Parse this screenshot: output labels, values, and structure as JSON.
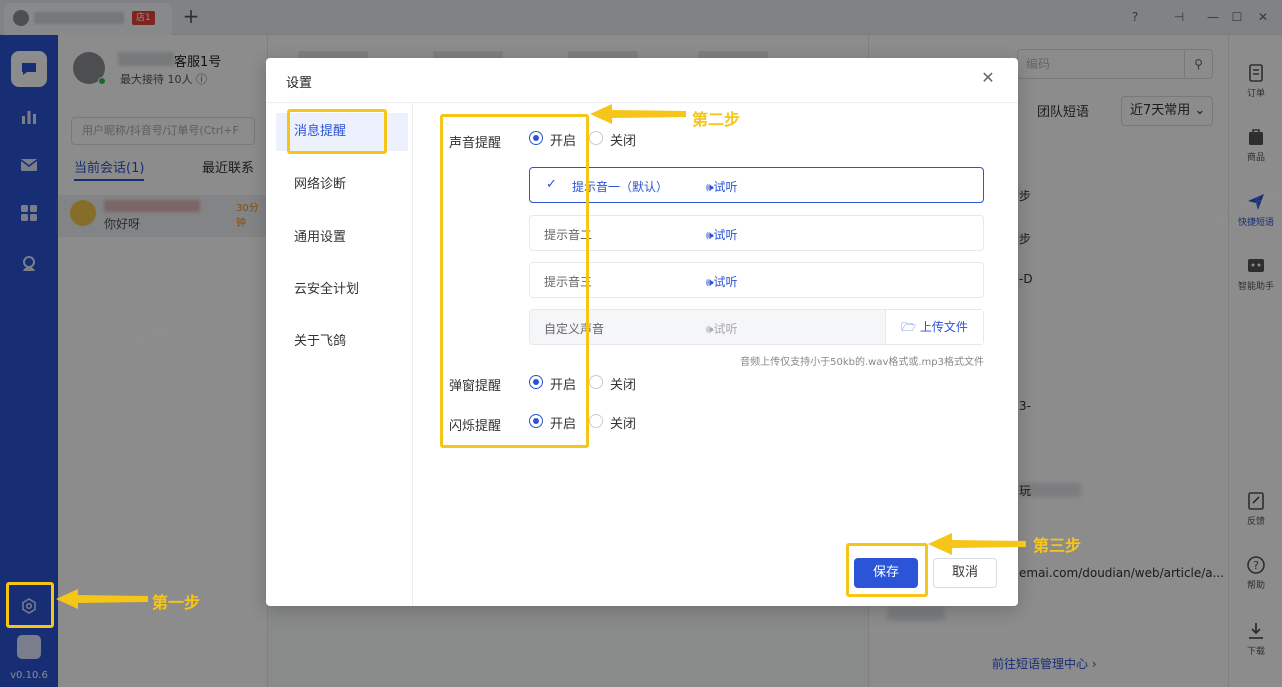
{
  "titlebar": {
    "tab_badge": "店1",
    "add_tab": "+",
    "controls": [
      "?",
      "⊣",
      "—",
      "☐",
      "✕"
    ]
  },
  "rail": {
    "items": [
      "chat-icon",
      "stats-icon",
      "mail-icon",
      "apps-icon",
      "support-icon"
    ],
    "version": "v0.10.6"
  },
  "agent": {
    "name": "客服1号",
    "max_reception": "最大接待 10人"
  },
  "sessions": {
    "search_placeholder": "用户昵称/抖音号/订单号(Ctrl+F",
    "tabs": [
      "当前会话(1)",
      "最近联系"
    ],
    "row": {
      "time": "30分钟",
      "message": "你好呀"
    }
  },
  "right_panel": {
    "search_placeholder": "编码",
    "tab_team": "团队短语",
    "select_value": "近7天常用",
    "fragments": [
      "步",
      "步",
      "-D",
      "3-",
      "玩",
      "emai.com/doudian/web/article/a..."
    ],
    "link": "前往短语管理中心 ›"
  },
  "right_tools": [
    {
      "icon": "order-icon",
      "label": "订单"
    },
    {
      "icon": "product-icon",
      "label": "商品"
    },
    {
      "icon": "quick-phrase-icon",
      "label": "快捷短语",
      "active": true
    },
    {
      "icon": "assistant-icon",
      "label": "智能助手"
    },
    {
      "icon": "feedback-icon",
      "label": "反馈"
    },
    {
      "icon": "help-icon",
      "label": "帮助"
    },
    {
      "icon": "download-icon",
      "label": "下载"
    }
  ],
  "dialog": {
    "title": "设置",
    "close": "✕",
    "nav": [
      "消息提醒",
      "网络诊断",
      "通用设置",
      "云安全计划",
      "关于飞鸽"
    ],
    "sound_label": "声音提醒",
    "popup_label": "弹窗提醒",
    "flash_label": "闪烁提醒",
    "on": "开启",
    "off": "关闭",
    "tones": [
      {
        "name": "提示音一（默认）",
        "try": "🕪试听"
      },
      {
        "name": "提示音二",
        "try": "🕪试听"
      },
      {
        "name": "提示音三",
        "try": "🕪试听"
      },
      {
        "name": "自定义声音",
        "try": "🕪试听"
      }
    ],
    "upload": "上传文件",
    "hint": "音频上传仅支持小于50kb的.wav格式或.mp3格式文件",
    "save": "保存",
    "cancel": "取消"
  },
  "watermark": "俞心萍 6685",
  "annotations": {
    "step1": "第一步",
    "step2": "第二步",
    "step3": "第三步",
    "color": "#f5c518"
  }
}
